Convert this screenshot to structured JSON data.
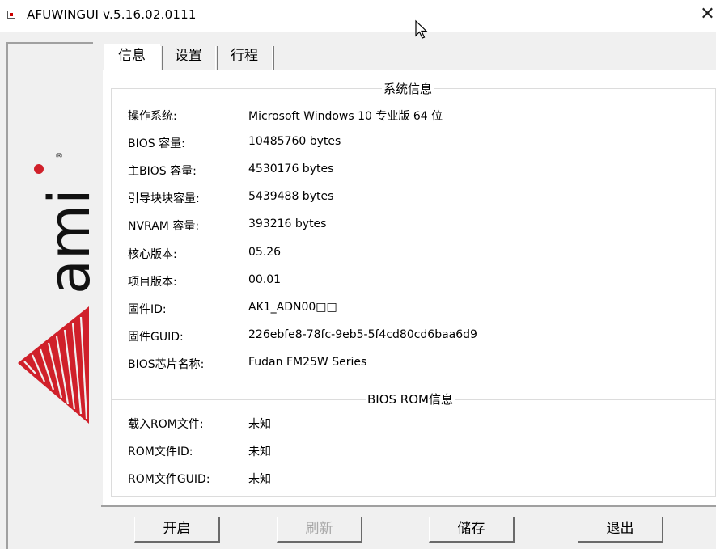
{
  "window": {
    "title": "AFUWINGUI v.5.16.02.0111",
    "close_glyph": "✕"
  },
  "logo": {
    "text": "ami",
    "registered_mark": "®",
    "accent_color": "#d0202a"
  },
  "tabs": [
    {
      "label": "信息",
      "active": true
    },
    {
      "label": "设置",
      "active": false
    },
    {
      "label": "行程",
      "active": false
    }
  ],
  "system_info": {
    "title": "系统信息",
    "rows": [
      {
        "label": "操作系统:",
        "value": "Microsoft Windows 10 专业版 64 位"
      },
      {
        "label": "BIOS 容量:",
        "value": "10485760 bytes"
      },
      {
        "label": "主BIOS 容量:",
        "value": "4530176 bytes"
      },
      {
        "label": "引导块块容量:",
        "value": "5439488 bytes"
      },
      {
        "label": "NVRAM 容量:",
        "value": "393216 bytes"
      },
      {
        "label": "核心版本:",
        "value": "05.26"
      },
      {
        "label": "项目版本:",
        "value": "00.01"
      },
      {
        "label": "固件ID:",
        "value": "AK1_ADN00□□"
      },
      {
        "label": "固件GUID:",
        "value": "226ebfe8-78fc-9eb5-5f4cd80cd6baa6d9"
      },
      {
        "label": "BIOS芯片名称:",
        "value": "Fudan FM25W Series"
      }
    ]
  },
  "rom_info": {
    "title": "BIOS ROM信息",
    "rows": [
      {
        "label": "载入ROM文件:",
        "value": "未知"
      },
      {
        "label": "ROM文件ID:",
        "value": "未知"
      },
      {
        "label": "ROM文件GUID:",
        "value": "未知"
      }
    ]
  },
  "buttons": {
    "start": "开启",
    "refresh": "刷新",
    "save": "储存",
    "exit": "退出"
  }
}
